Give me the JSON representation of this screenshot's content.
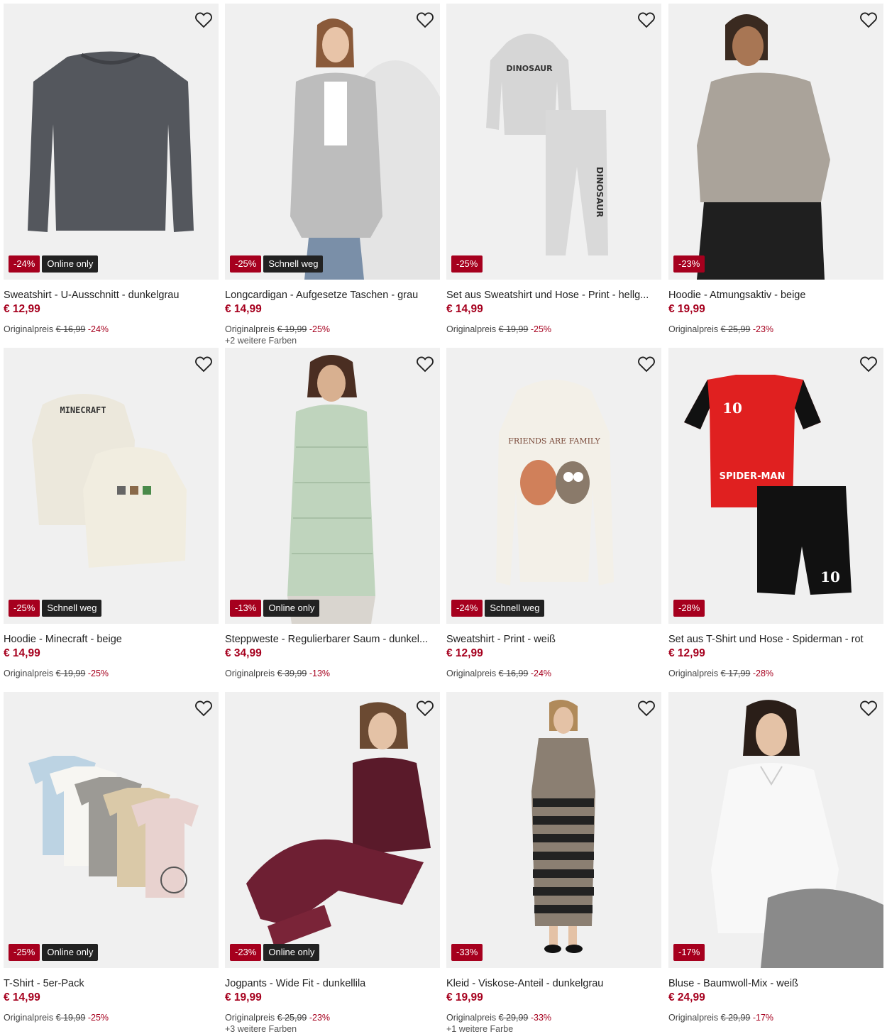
{
  "labels": {
    "original_price": "Originalpreis",
    "wishlist_icon": "heart-outline-icon"
  },
  "colors": {
    "sale_red": "#a6001e",
    "tag_dark": "#222222",
    "image_bg": "#f0f0f0"
  },
  "products": [
    {
      "title": "Sweatshirt - U-Ausschnitt - dunkelgrau",
      "price": "€ 12,99",
      "original": "€ 16,99",
      "discount": "-24%",
      "tag": "Online only",
      "more": ""
    },
    {
      "title": "Longcardigan - Aufgesetze Taschen - grau",
      "price": "€ 14,99",
      "original": "€ 19,99",
      "discount": "-25%",
      "tag": "Schnell weg",
      "more": "+2 weitere Farben"
    },
    {
      "title": "Set aus Sweatshirt und Hose - Print - hellg...",
      "price": "€ 14,99",
      "original": "€ 19,99",
      "discount": "-25%",
      "tag": "",
      "more": ""
    },
    {
      "title": "Hoodie - Atmungsaktiv - beige",
      "price": "€ 19,99",
      "original": "€ 25,99",
      "discount": "-23%",
      "tag": "",
      "more": ""
    },
    {
      "title": "Hoodie - Minecraft - beige",
      "price": "€ 14,99",
      "original": "€ 19,99",
      "discount": "-25%",
      "tag": "Schnell weg",
      "more": ""
    },
    {
      "title": "Steppweste - Regulierbarer Saum - dunkel...",
      "price": "€ 34,99",
      "original": "€ 39,99",
      "discount": "-13%",
      "tag": "Online only",
      "more": ""
    },
    {
      "title": "Sweatshirt - Print - weiß",
      "price": "€ 12,99",
      "original": "€ 16,99",
      "discount": "-24%",
      "tag": "Schnell weg",
      "more": ""
    },
    {
      "title": "Set aus T-Shirt und Hose - Spiderman - rot",
      "price": "€ 12,99",
      "original": "€ 17,99",
      "discount": "-28%",
      "tag": "",
      "more": ""
    },
    {
      "title": "T-Shirt - 5er-Pack",
      "price": "€ 14,99",
      "original": "€ 19,99",
      "discount": "-25%",
      "tag": "Online only",
      "more": ""
    },
    {
      "title": "Jogpants - Wide Fit - dunkellila",
      "price": "€ 19,99",
      "original": "€ 25,99",
      "discount": "-23%",
      "tag": "Online only",
      "more": "+3 weitere Farben"
    },
    {
      "title": "Kleid - Viskose-Anteil - dunkelgrau",
      "price": "€ 19,99",
      "original": "€ 29,99",
      "discount": "-33%",
      "tag": "",
      "more": "+1 weitere Farbe"
    },
    {
      "title": "Bluse - Baumwoll-Mix - weiß",
      "price": "€ 24,99",
      "original": "€ 29,99",
      "discount": "-17%",
      "tag": "",
      "more": ""
    }
  ],
  "print_text": {
    "dinosaur": "DINOSAUR",
    "minecraft": "MINECRAFT",
    "friends": "FRIENDS ARE FAMILY",
    "spiderman": "SPIDER-MAN",
    "number": "10"
  }
}
